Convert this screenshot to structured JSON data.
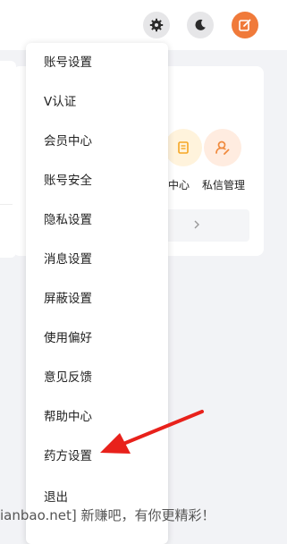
{
  "header": {
    "settings_icon": "gear-icon",
    "theme_icon": "moon-icon",
    "publish_icon": "edit-icon",
    "accent_color": "#f07a3a"
  },
  "settings_menu": {
    "items": [
      {
        "label": "账号设置"
      },
      {
        "label": "V认证"
      },
      {
        "label": "会员中心"
      },
      {
        "label": "账号安全"
      },
      {
        "label": "隐私设置"
      },
      {
        "label": "消息设置"
      },
      {
        "label": "屏蔽设置"
      },
      {
        "label": "使用偏好"
      },
      {
        "label": "意见反馈"
      },
      {
        "label": "帮助中心"
      },
      {
        "label": "药方设置"
      },
      {
        "label": "退出"
      }
    ]
  },
  "background_card": {
    "items": [
      {
        "label": "中心",
        "icon": "document-icon"
      },
      {
        "label": "私信管理",
        "icon": "user-edit-icon"
      }
    ],
    "chevron_icon": "chevron-right-icon"
  },
  "annotation": {
    "arrow_color": "#e8211b",
    "target_label": "药方设置"
  },
  "watermark": {
    "text": "ianbao.net] 新赚吧，有你更精彩！"
  }
}
